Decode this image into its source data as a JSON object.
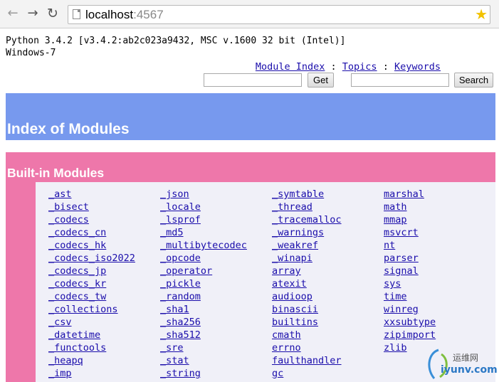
{
  "browser": {
    "url_host": "localhost",
    "url_port": ":4567"
  },
  "sysinfo": {
    "python": "Python 3.4.2 [v3.4.2:ab2c023a9432, MSC v.1600 32 bit (Intel)]",
    "os": "Windows-7"
  },
  "toplinks": {
    "module_index": "Module Index",
    "topics": "Topics",
    "keywords": "Keywords",
    "sep": " : "
  },
  "search": {
    "get_label": "Get",
    "search_label": "Search"
  },
  "index_title": "Index of Modules",
  "builtin_title": "Built-in Modules",
  "modules": {
    "col1": [
      "_ast",
      "_bisect",
      "_codecs",
      "_codecs_cn",
      "_codecs_hk",
      "_codecs_iso2022",
      "_codecs_jp",
      "_codecs_kr",
      "_codecs_tw",
      "_collections",
      "_csv",
      "_datetime",
      "_functools",
      "_heapq",
      "_imp"
    ],
    "col2": [
      "_json",
      "_locale",
      "_lsprof",
      "_md5",
      "_multibytecodec",
      "_opcode",
      "_operator",
      "_pickle",
      "_random",
      "_sha1",
      "_sha256",
      "_sha512",
      "_sre",
      "_stat",
      "_string"
    ],
    "col3": [
      "_symtable",
      "_thread",
      "_tracemalloc",
      "_warnings",
      "_weakref",
      "_winapi",
      "array",
      "atexit",
      "audioop",
      "binascii",
      "builtins",
      "cmath",
      "errno",
      "faulthandler",
      "gc"
    ],
    "col4": [
      "marshal",
      "math",
      "mmap",
      "msvcrt",
      "nt",
      "parser",
      "signal",
      "sys",
      "time",
      "winreg",
      "xxsubtype",
      "zipimport",
      "zlib"
    ]
  },
  "watermark": {
    "line1": "运维网",
    "line2": "iyunv.com"
  }
}
